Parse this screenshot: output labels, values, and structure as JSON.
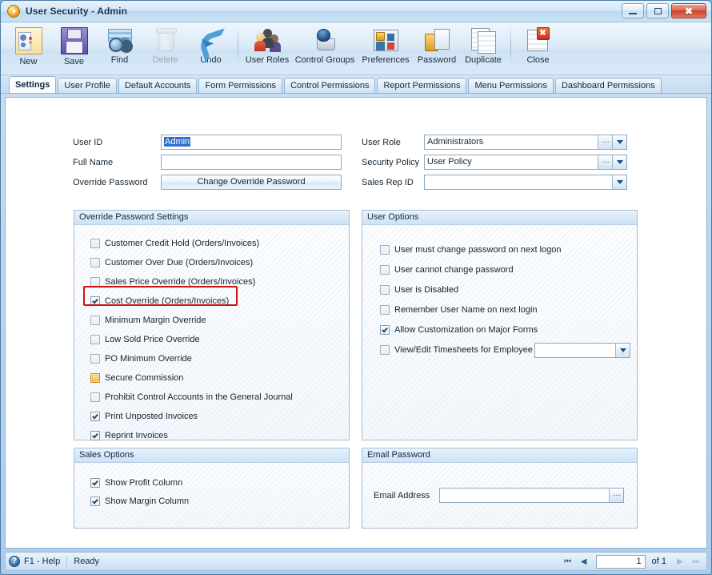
{
  "window": {
    "title": "User Security - Admin",
    "app_icon": "play-circle-icon",
    "buttons": {
      "minimize": "minimize-icon",
      "maximize": "maximize-icon",
      "close": "✖"
    }
  },
  "toolbar": {
    "items": [
      {
        "label": "New",
        "icon": "new-record-icon",
        "enabled": true,
        "key": "new"
      },
      {
        "label": "Save",
        "icon": "save-floppy-icon",
        "enabled": true,
        "key": "save"
      },
      {
        "label": "Find",
        "icon": "find-binoculars-icon",
        "enabled": true,
        "key": "find"
      },
      {
        "label": "Delete",
        "icon": "delete-trash-icon",
        "enabled": false,
        "key": "del"
      },
      {
        "label": "Undo",
        "icon": "undo-arrow-icon",
        "enabled": true,
        "key": "undo"
      },
      {
        "label": "User Roles",
        "icon": "user-roles-icon",
        "enabled": true,
        "key": "roles"
      },
      {
        "label": "Control Groups",
        "icon": "control-groups-icon",
        "enabled": true,
        "key": "cg"
      },
      {
        "label": "Preferences",
        "icon": "preferences-icon",
        "enabled": true,
        "key": "pref"
      },
      {
        "label": "Password",
        "icon": "password-lock-icon",
        "enabled": true,
        "key": "pwd"
      },
      {
        "label": "Duplicate",
        "icon": "duplicate-icon",
        "enabled": true,
        "key": "dup"
      },
      {
        "label": "Close",
        "icon": "close-document-icon",
        "enabled": true,
        "key": "close2"
      }
    ]
  },
  "tabs": [
    {
      "label": "Settings",
      "active": true
    },
    {
      "label": "User Profile",
      "active": false
    },
    {
      "label": "Default Accounts",
      "active": false
    },
    {
      "label": "Form Permissions",
      "active": false
    },
    {
      "label": "Control Permissions",
      "active": false
    },
    {
      "label": "Report Permissions",
      "active": false
    },
    {
      "label": "Menu Permissions",
      "active": false
    },
    {
      "label": "Dashboard Permissions",
      "active": false
    }
  ],
  "form": {
    "user_id": {
      "label": "User ID",
      "value": "Admin",
      "selected": true
    },
    "full_name": {
      "label": "Full Name",
      "value": ""
    },
    "override_password": {
      "label": "Override Password",
      "button_label": "Change Override Password"
    },
    "user_role": {
      "label": "User Role",
      "value": "Administrators"
    },
    "security_policy": {
      "label": "Security Policy",
      "value": "User Policy"
    },
    "sales_rep_id": {
      "label": "Sales Rep ID",
      "value": ""
    }
  },
  "override_password_settings": {
    "title": "Override Password Settings",
    "items": [
      {
        "label": "Customer Credit Hold (Orders/Invoices)",
        "state": "off"
      },
      {
        "label": "Customer Over Due (Orders/Invoices)",
        "state": "off"
      },
      {
        "label": "Sales Price Override (Orders/Invoices)",
        "state": "off"
      },
      {
        "label": "Cost Override (Orders/Invoices)",
        "state": "on",
        "highlighted": true
      },
      {
        "label": "Minimum Margin Override",
        "state": "off"
      },
      {
        "label": "Low Sold Price Override",
        "state": "off"
      },
      {
        "label": "PO Minimum Override",
        "state": "off"
      },
      {
        "label": "Secure Commission",
        "state": "amber"
      },
      {
        "label": "Prohibit Control Accounts in the General Journal",
        "state": "off"
      },
      {
        "label": "Print Unposted Invoices",
        "state": "on"
      },
      {
        "label": "Reprint Invoices",
        "state": "on"
      }
    ]
  },
  "user_options": {
    "title": "User Options",
    "items": [
      {
        "label": "User must change password on next logon",
        "state": "off"
      },
      {
        "label": "User cannot change password",
        "state": "off"
      },
      {
        "label": "User is Disabled",
        "state": "off"
      },
      {
        "label": "Remember User Name on next login",
        "state": "off"
      },
      {
        "label": "Allow Customization on Major Forms",
        "state": "on"
      },
      {
        "label": "View/Edit Timesheets for Employee",
        "state": "off",
        "combo_value": ""
      }
    ]
  },
  "sales_options": {
    "title": "Sales Options",
    "items": [
      {
        "label": "Show Profit Column",
        "state": "on"
      },
      {
        "label": "Show Margin Column",
        "state": "on"
      }
    ]
  },
  "email_password": {
    "title": "Email Password",
    "email_label": "Email Address",
    "email_value": ""
  },
  "statusbar": {
    "help_icon": "?",
    "help_label": "F1 - Help",
    "status": "Ready",
    "nav": {
      "first": "⏮",
      "prev": "◀",
      "page": "1",
      "of": "of 1",
      "next": "▶",
      "last": "⏭"
    }
  },
  "colors": {
    "highlight_red": "#cc1111",
    "selection_blue": "#2f6fd0",
    "amber_checkbox": "#f2c34e",
    "titlebar_text": "#11334f"
  }
}
